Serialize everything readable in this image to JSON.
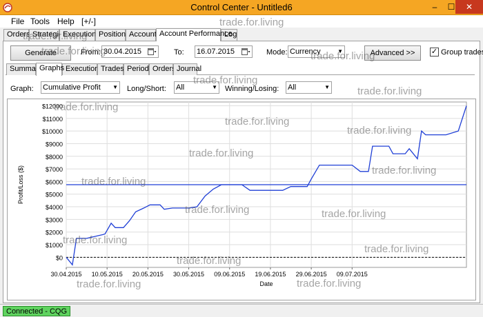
{
  "window": {
    "title": "Control Center - Untitled6",
    "min": "–",
    "max": "☐",
    "close": "✕"
  },
  "menu": [
    "File",
    "Tools",
    "Help",
    "[+/-]"
  ],
  "main_tabs": [
    "Orders",
    "Strategies",
    "Executions",
    "Positions",
    "Accounts",
    "Account Performance",
    "Log"
  ],
  "toolbar": {
    "generate": "Generate",
    "from_label": "From:",
    "from_value": "30.04.2015",
    "to_label": "To:",
    "to_value": "16.07.2015",
    "mode_label": "Mode:",
    "mode_value": "Currency",
    "advanced": "Advanced >>",
    "group_trades": "Group trades",
    "group_trades_checked": "✓"
  },
  "sub_tabs": [
    "Summary",
    "Graphs",
    "Executions",
    "Trades",
    "Periods",
    "Orders",
    "Journal"
  ],
  "filters": {
    "graph_label": "Graph:",
    "graph_value": "Cumulative Profit",
    "longshort_label": "Long/Short:",
    "longshort_value": "All",
    "winlose_label": "Winning/Losing:",
    "winlose_value": "All"
  },
  "watermark": "trade.for.living",
  "status": {
    "connection": "Connected - CQG"
  },
  "chart_data": {
    "type": "line",
    "xlabel": "Date",
    "ylabel": "Profit/Loss ($)",
    "x_ticks": [
      "30.04.2015",
      "10.05.2015",
      "20.05.2015",
      "30.05.2015",
      "09.06.2015",
      "19.06.2015",
      "29.06.2015",
      "09.07.2015"
    ],
    "y_ticks": [
      "$0",
      "$1000",
      "$2000",
      "$3000",
      "$4000",
      "$5000",
      "$6000",
      "$7000",
      "$8000",
      "$9000",
      "$10000",
      "$11000",
      "$12000"
    ],
    "ylim": [
      -800,
      12300
    ],
    "xlim": [
      0,
      78
    ],
    "average_line": 5750,
    "series": [
      {
        "color": "#1f3fd6",
        "points": [
          [
            0,
            0
          ],
          [
            1.5,
            -600
          ],
          [
            2.5,
            1500
          ],
          [
            5,
            1500
          ],
          [
            7,
            1650
          ],
          [
            9,
            1800
          ],
          [
            9.5,
            1850
          ],
          [
            11,
            2700
          ],
          [
            12,
            2350
          ],
          [
            14,
            2350
          ],
          [
            15.5,
            2900
          ],
          [
            17,
            3600
          ],
          [
            19,
            3900
          ],
          [
            20.5,
            4150
          ],
          [
            22,
            4150
          ],
          [
            23,
            4150
          ],
          [
            24,
            3800
          ],
          [
            26,
            3900
          ],
          [
            30,
            3900
          ],
          [
            32,
            4000
          ],
          [
            34,
            4850
          ],
          [
            36,
            5400
          ],
          [
            38,
            5750
          ],
          [
            43,
            5750
          ],
          [
            45,
            5300
          ],
          [
            53,
            5300
          ],
          [
            55,
            5600
          ],
          [
            59,
            5600
          ],
          [
            60,
            6200
          ],
          [
            62,
            7300
          ],
          [
            70,
            7300
          ],
          [
            72,
            6800
          ],
          [
            74,
            6800
          ],
          [
            75,
            8800
          ],
          [
            79,
            8800
          ],
          [
            80,
            8200
          ],
          [
            83,
            8200
          ],
          [
            84,
            8600
          ],
          [
            86,
            7800
          ],
          [
            87,
            10000
          ],
          [
            88,
            9700
          ],
          [
            93,
            9700
          ],
          [
            96,
            10000
          ],
          [
            98,
            12000
          ]
        ]
      }
    ],
    "x_tick_pos": [
      0,
      10,
      20,
      30,
      40,
      50,
      60,
      70
    ]
  }
}
